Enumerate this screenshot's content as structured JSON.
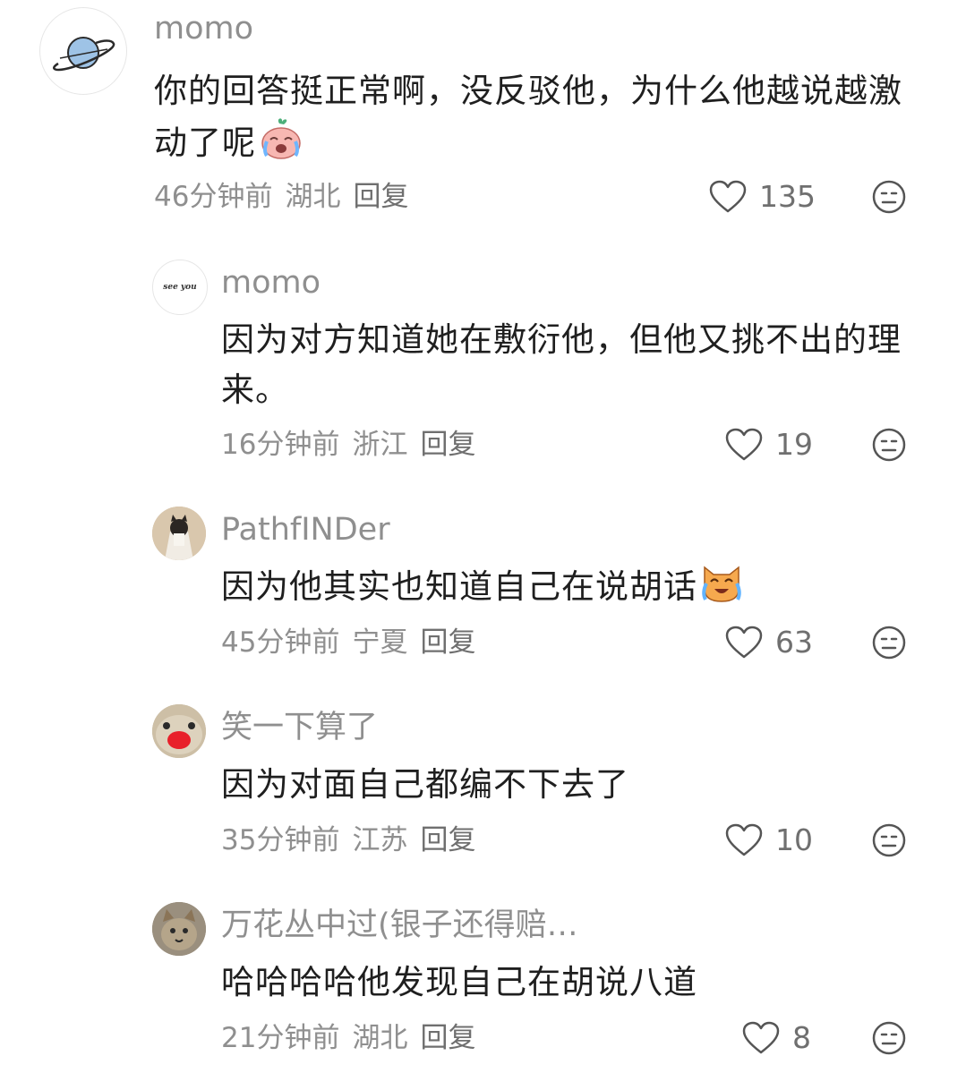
{
  "comments": [
    {
      "username": "momo",
      "text": "你的回答挺正常啊，没反驳他，为什么他越说越激动了呢",
      "emoji": "crying-laughing-peach",
      "time": "46分钟前",
      "location": "湖北",
      "reply": "回复",
      "likes": "135"
    },
    {
      "username": "momo",
      "text": "因为对方知道她在敷衍他，但他又挑不出的理来。",
      "time": "16分钟前",
      "location": "浙江",
      "reply": "回复",
      "likes": "19",
      "avatar_text": "see you"
    },
    {
      "username": "PathfINDer",
      "text": "因为他其实也知道自己在说胡话",
      "emoji": "crying-laughing-cat",
      "time": "45分钟前",
      "location": "宁夏",
      "reply": "回复",
      "likes": "63"
    },
    {
      "username": "笑一下算了",
      "text": "因为对面自己都编不下去了",
      "time": "35分钟前",
      "location": "江苏",
      "reply": "回复",
      "likes": "10"
    },
    {
      "username": "万花丛中过(银子还得赔…",
      "text": "哈哈哈哈他发现自己在胡说八道",
      "time": "21分钟前",
      "location": "湖北",
      "reply": "回复",
      "likes": "8"
    }
  ],
  "colors": {
    "meta": "#8f8f8f",
    "text": "#1f1f1f",
    "icon": "#555555"
  }
}
